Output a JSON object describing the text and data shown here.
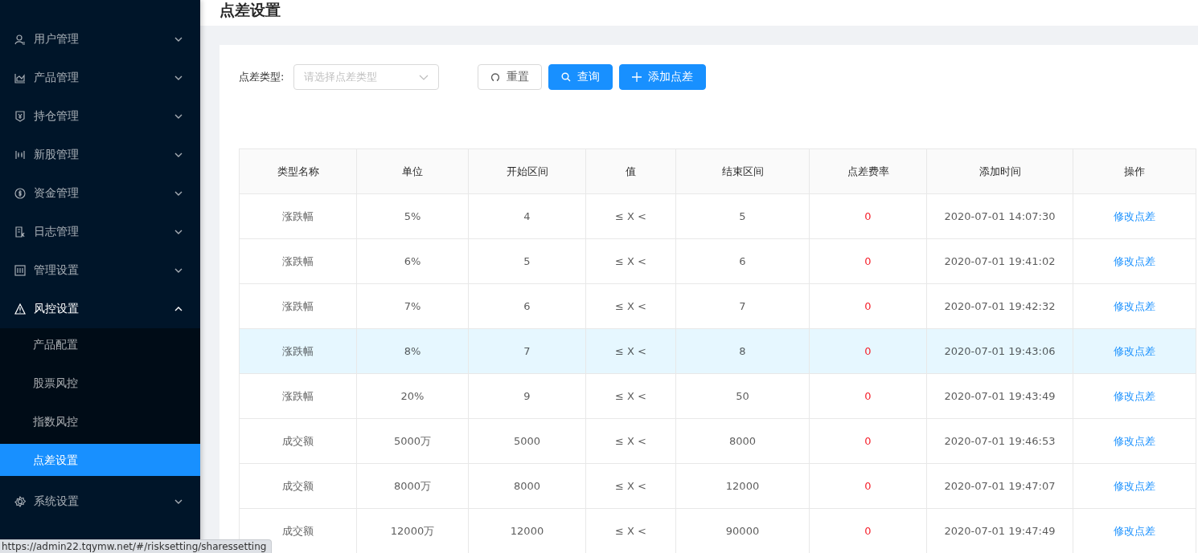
{
  "sidebar": {
    "items": [
      {
        "label": "用户管理",
        "expanded": false
      },
      {
        "label": "产品管理",
        "expanded": false
      },
      {
        "label": "持仓管理",
        "expanded": false
      },
      {
        "label": "新股管理",
        "expanded": false
      },
      {
        "label": "资金管理",
        "expanded": false
      },
      {
        "label": "日志管理",
        "expanded": false
      },
      {
        "label": "管理设置",
        "expanded": false
      },
      {
        "label": "风控设置",
        "expanded": true,
        "children": [
          {
            "label": "产品配置",
            "selected": false
          },
          {
            "label": "股票风控",
            "selected": false
          },
          {
            "label": "指数风控",
            "selected": false
          },
          {
            "label": "点差设置",
            "selected": true
          }
        ]
      },
      {
        "label": "系统设置",
        "expanded": false
      }
    ]
  },
  "page_title": "点差设置",
  "filter": {
    "label": "点差类型:",
    "placeholder": "请选择点差类型"
  },
  "buttons": [
    {
      "label": "重置",
      "kind": "reset"
    },
    {
      "label": "查询",
      "kind": "search"
    },
    {
      "label": "添加点差",
      "kind": "add"
    }
  ],
  "table": {
    "columns": [
      "类型名称",
      "单位",
      "开始区间",
      "值",
      "结束区间",
      "点差费率",
      "添加时间",
      "操作"
    ],
    "rows": [
      {
        "highlighted": false,
        "cells": [
          "涨跌幅",
          "5%",
          "4",
          "≤ X <",
          "5",
          "0",
          "2020-07-01 14:07:30",
          "修改点差"
        ]
      },
      {
        "highlighted": false,
        "cells": [
          "涨跌幅",
          "6%",
          "5",
          "≤ X <",
          "6",
          "0",
          "2020-07-01 19:41:02",
          "修改点差"
        ]
      },
      {
        "highlighted": false,
        "cells": [
          "涨跌幅",
          "7%",
          "6",
          "≤ X <",
          "7",
          "0",
          "2020-07-01 19:42:32",
          "修改点差"
        ]
      },
      {
        "highlighted": true,
        "cells": [
          "涨跌幅",
          "8%",
          "7",
          "≤ X <",
          "8",
          "0",
          "2020-07-01 19:43:06",
          "修改点差"
        ]
      },
      {
        "highlighted": false,
        "cells": [
          "涨跌幅",
          "20%",
          "9",
          "≤ X <",
          "50",
          "0",
          "2020-07-01 19:43:49",
          "修改点差"
        ]
      },
      {
        "highlighted": false,
        "cells": [
          "成交额",
          "5000万",
          "5000",
          "≤ X <",
          "8000",
          "0",
          "2020-07-01 19:46:53",
          "修改点差"
        ]
      },
      {
        "highlighted": false,
        "cells": [
          "成交额",
          "8000万",
          "8000",
          "≤ X <",
          "12000",
          "0",
          "2020-07-01 19:47:07",
          "修改点差"
        ]
      },
      {
        "highlighted": false,
        "cells": [
          "成交额",
          "12000万",
          "12000",
          "≤ X <",
          "90000",
          "0",
          "2020-07-01 19:47:49",
          "修改点差"
        ]
      }
    ]
  },
  "status_url": "https://admin22.tqymw.net/#/risksetting/sharessetting"
}
